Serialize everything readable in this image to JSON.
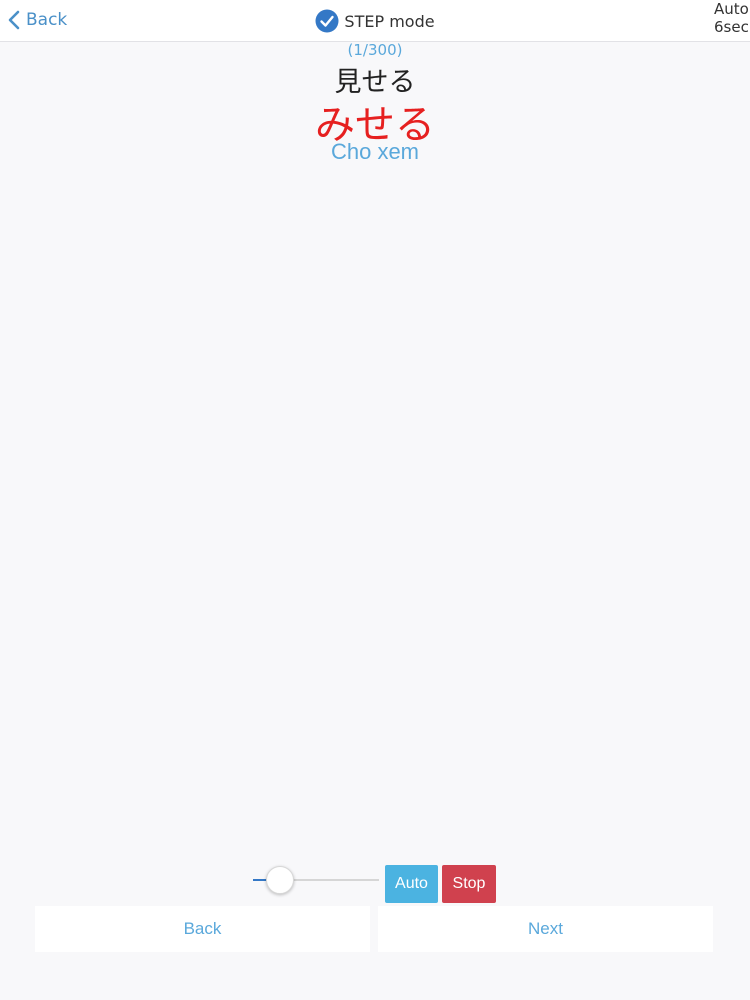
{
  "nav": {
    "back_label": "Back",
    "title": "STEP mode",
    "auto_label": "Auto",
    "auto_interval": "6sec"
  },
  "card": {
    "counter": "(1/300)",
    "kanji": "見せる",
    "reading": "みせる",
    "meaning": "Cho xem"
  },
  "controls": {
    "slider_value": 0.13,
    "auto_label": "Auto",
    "stop_label": "Stop"
  },
  "footer": {
    "back_label": "Back",
    "next_label": "Next"
  },
  "colors": {
    "accent": "#4a90c8",
    "reading": "#e62020",
    "auto_button": "#4bb3e1",
    "stop_button": "#d0414e"
  }
}
